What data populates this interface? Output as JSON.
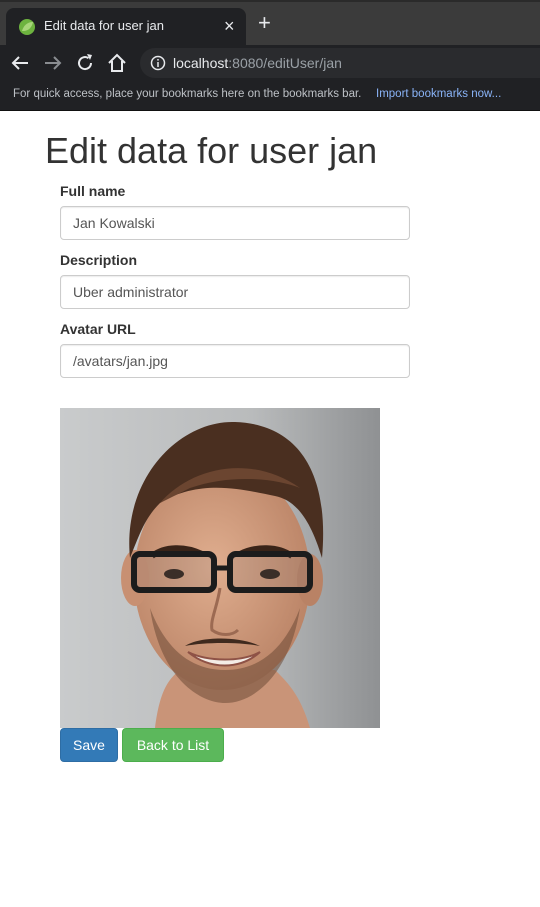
{
  "browser": {
    "tab_title": "Edit data for user jan",
    "close_glyph": "×",
    "newtab_glyph": "+",
    "url_host": "localhost",
    "url_path": ":8080/editUser/jan",
    "bookmarks_hint": "For quick access, place your bookmarks here on the bookmarks bar.",
    "import_bookmarks": "Import bookmarks now..."
  },
  "page": {
    "title": "Edit data for user jan",
    "fields": {
      "full_name": {
        "label": "Full name",
        "value": "Jan Kowalski"
      },
      "description": {
        "label": "Description",
        "value": "Uber administrator"
      },
      "avatar_url": {
        "label": "Avatar URL",
        "value": "/avatars/jan.jpg"
      }
    },
    "buttons": {
      "save": "Save",
      "back": "Back to List"
    }
  },
  "colors": {
    "primary": "#337ab7",
    "success": "#5cb85c",
    "link": "#8ab4f8"
  }
}
